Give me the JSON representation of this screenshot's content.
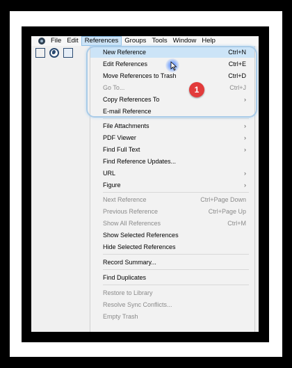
{
  "menubar": {
    "items": [
      {
        "label": "File"
      },
      {
        "label": "Edit"
      },
      {
        "label": "References"
      },
      {
        "label": "Groups"
      },
      {
        "label": "Tools"
      },
      {
        "label": "Window"
      },
      {
        "label": "Help"
      }
    ]
  },
  "toolbar": {
    "icons": [
      "library-icon",
      "globe-icon",
      "document-icon"
    ]
  },
  "menu": {
    "items": [
      {
        "label": "New Reference",
        "shortcut": "Ctrl+N"
      },
      {
        "label": "Edit References",
        "shortcut": "Ctrl+E"
      },
      {
        "label": "Move References to Trash",
        "shortcut": "Ctrl+D"
      },
      {
        "label": "Go To...",
        "shortcut": "Ctrl+J"
      },
      {
        "label": "Copy References To",
        "shortcut": "›"
      },
      {
        "label": "E-mail Reference",
        "shortcut": ""
      },
      {
        "label": "File Attachments",
        "shortcut": "›"
      },
      {
        "label": "PDF Viewer",
        "shortcut": "›"
      },
      {
        "label": "Find Full Text",
        "shortcut": "›"
      },
      {
        "label": "Find Reference Updates...",
        "shortcut": ""
      },
      {
        "label": "URL",
        "shortcut": "›"
      },
      {
        "label": "Figure",
        "shortcut": "›"
      },
      {
        "label": "Next Reference",
        "shortcut": "Ctrl+Page Down"
      },
      {
        "label": "Previous Reference",
        "shortcut": "Ctrl+Page Up"
      },
      {
        "label": "Show All References",
        "shortcut": "Ctrl+M"
      },
      {
        "label": "Show Selected References",
        "shortcut": ""
      },
      {
        "label": "Hide Selected References",
        "shortcut": ""
      },
      {
        "label": "Record Summary...",
        "shortcut": ""
      },
      {
        "label": "Find Duplicates",
        "shortcut": ""
      },
      {
        "label": "Restore to Library",
        "shortcut": ""
      },
      {
        "label": "Resolve Sync Conflicts...",
        "shortcut": ""
      },
      {
        "label": "Empty Trash",
        "shortcut": ""
      }
    ]
  },
  "annotation": {
    "step": "1"
  },
  "colors": {
    "selected": "#cce4f7",
    "badge": "#e23b3b",
    "highlight": "#a9cbe8"
  }
}
